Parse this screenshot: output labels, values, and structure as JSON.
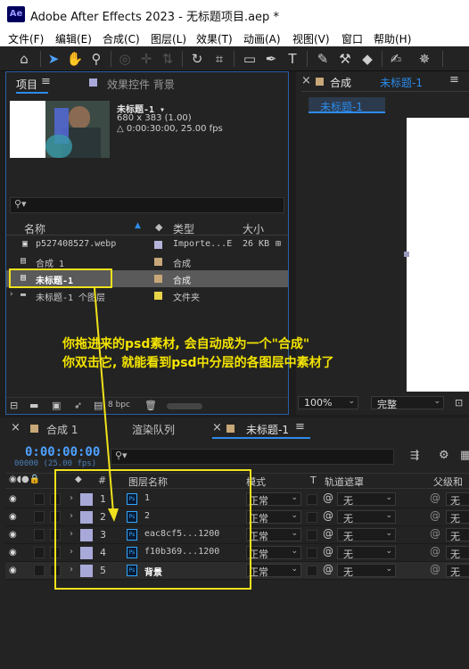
{
  "app": {
    "logo_text": "Ae",
    "window_title": "Adobe After Effects 2023 - 无标题项目.aep *"
  },
  "menu": [
    "文件(F)",
    "编辑(E)",
    "合成(C)",
    "图层(L)",
    "效果(T)",
    "动画(A)",
    "视图(V)",
    "窗口",
    "帮助(H)"
  ],
  "project_panel": {
    "tab_project": "项目",
    "tab_effects": "效果控件 背景",
    "preview": {
      "name": "未标题-1 ▾",
      "size": "680 x 383 (1.00)",
      "duration": "△ 0:00:30:00, 25.00 fps"
    },
    "columns": {
      "name": "名称",
      "type": "类型",
      "size": "大小"
    },
    "items": [
      {
        "name": "p527408527.webp",
        "type": "Importe...E",
        "size": "26 KB",
        "label_color": "#b4b4d8"
      },
      {
        "name": "合成 1",
        "type": "合成",
        "size": "",
        "label_color": "#c8a878"
      },
      {
        "name": "未标题-1",
        "type": "合成",
        "size": "",
        "label_color": "#c8a878"
      },
      {
        "name": "未标题-1 个图层",
        "type": "文件夹",
        "size": "",
        "label_color": "#e8d448"
      }
    ],
    "bpc": "8 bpc"
  },
  "comp_panel": {
    "tab_label": "合成",
    "tab_comp_name": "未标题-1",
    "comp_button": "未标题-1",
    "zoom": "100%",
    "quality": "完整"
  },
  "timeline": {
    "tabs": [
      "合成 1",
      "渲染队列",
      "未标题-1"
    ],
    "timecode": "0:00:00:00",
    "timecode_sub": "00000 (25.00 fps)",
    "columns": {
      "num": "#",
      "layer_name": "图层名称",
      "mode": "模式",
      "t": "T",
      "track_matte": "轨道遮罩",
      "parent": "父级和"
    },
    "layers": [
      {
        "num": "1",
        "name": "1",
        "mode": "正常",
        "matte": "无",
        "parent": "无"
      },
      {
        "num": "2",
        "name": "2",
        "mode": "正常",
        "matte": "无",
        "parent": "无"
      },
      {
        "num": "3",
        "name": "eac8cf5...1200",
        "mode": "正常",
        "matte": "无",
        "parent": "无"
      },
      {
        "num": "4",
        "name": "f10b369...1200",
        "mode": "正常",
        "matte": "无",
        "parent": "无"
      },
      {
        "num": "5",
        "name": "背景",
        "mode": "正常",
        "matte": "无",
        "parent": "无"
      }
    ]
  },
  "annotation": {
    "line1": "你拖进来的psd素材, 会自动成为一个\"合成\"",
    "line2": "你双击它, 就能看到psd中分层的各图层中素材了"
  },
  "colors": {
    "accent_blue": "#2d8ceb",
    "highlight_yellow": "#f0e11c",
    "layer_label": "#a9a9d9"
  }
}
